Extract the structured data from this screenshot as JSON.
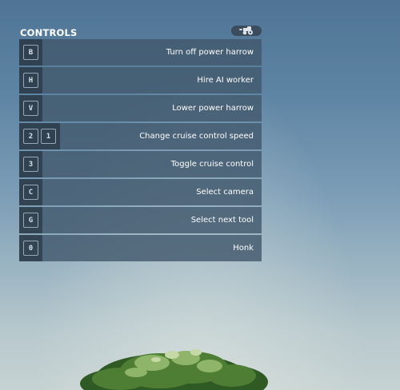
{
  "panel": {
    "title": "CONTROLS"
  },
  "controls": [
    {
      "keys": [
        "B"
      ],
      "action": "Turn off power harrow"
    },
    {
      "keys": [
        "H"
      ],
      "action": "Hire AI worker"
    },
    {
      "keys": [
        "V"
      ],
      "action": "Lower power harrow"
    },
    {
      "keys": [
        "2",
        "1"
      ],
      "action": "Change cruise control speed"
    },
    {
      "keys": [
        "3"
      ],
      "action": "Toggle cruise control"
    },
    {
      "keys": [
        "C"
      ],
      "action": "Select camera"
    },
    {
      "keys": [
        "G"
      ],
      "action": "Select next tool"
    },
    {
      "keys": [
        "0"
      ],
      "action": "Honk"
    }
  ],
  "icons": {
    "badge": "tractor-icon"
  },
  "colors": {
    "panel_row": "#41576c",
    "key_column": "#263442",
    "text": "#ffffff"
  }
}
